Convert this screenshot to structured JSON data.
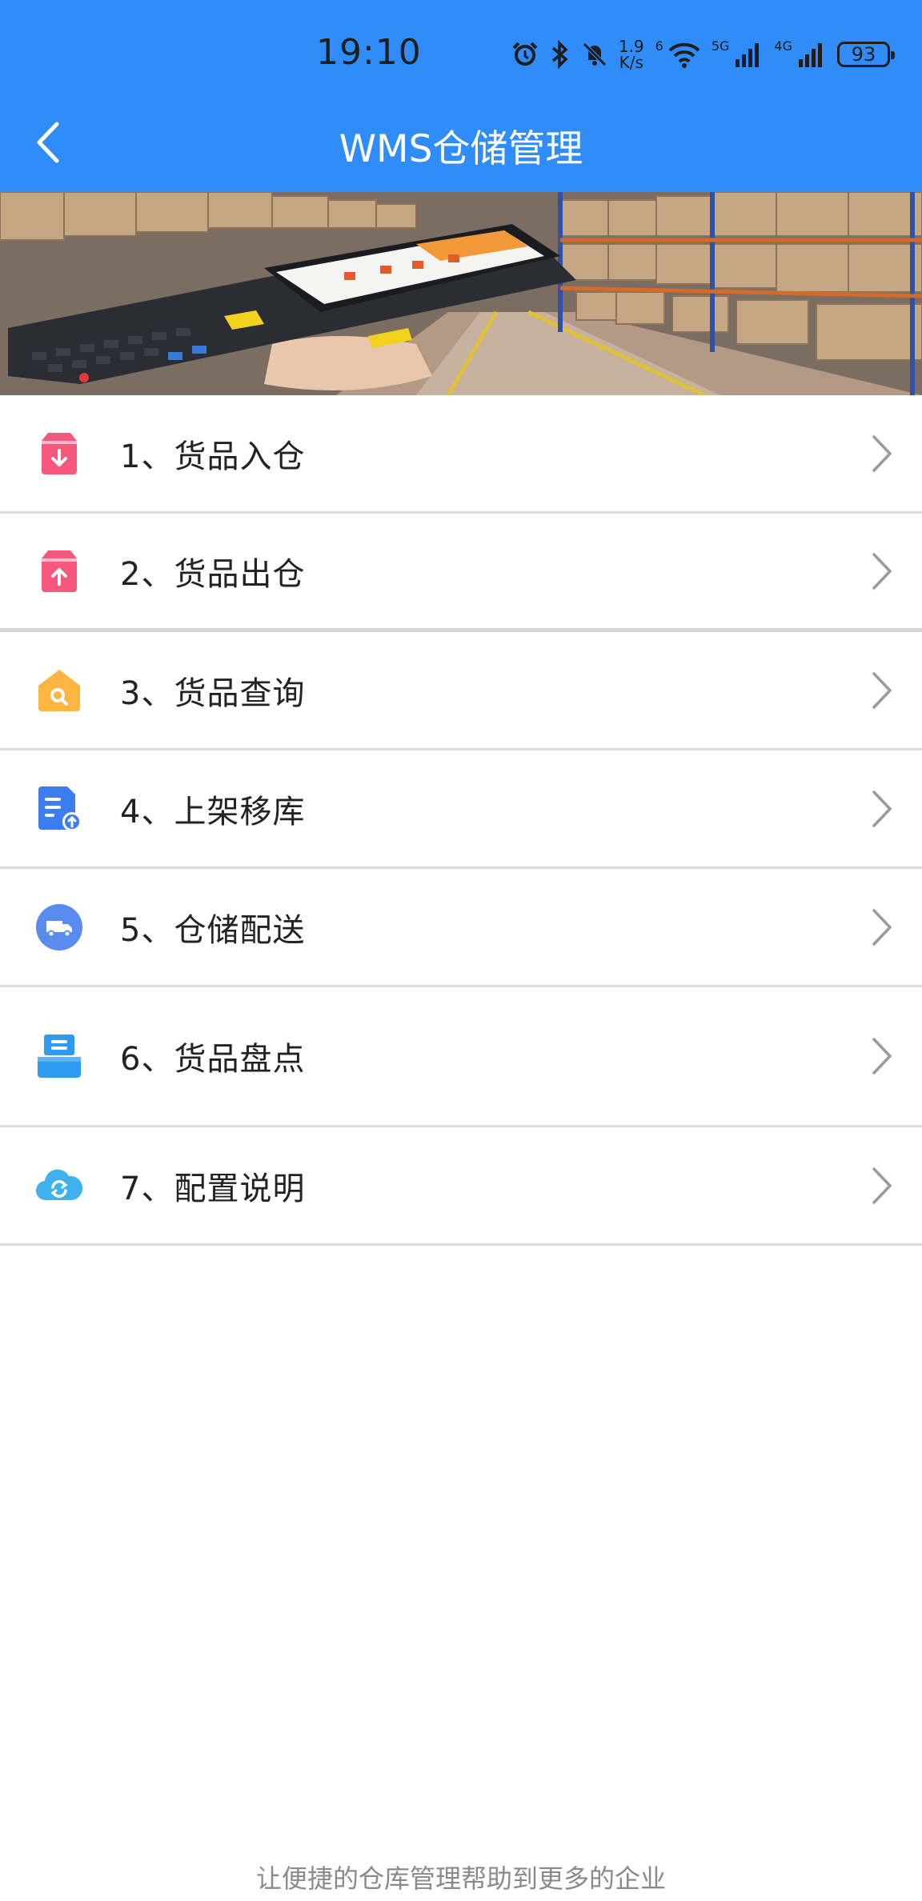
{
  "status_bar": {
    "time": "19:10",
    "net_speed_value": "1.9",
    "net_speed_unit": "K/s",
    "wifi_tag": "6",
    "sim1_label": "5G",
    "sim2_label": "4G",
    "battery": "93"
  },
  "header": {
    "title": "WMS仓储管理",
    "back_icon": "chevron-left-icon",
    "background_color": "#2f8cf9"
  },
  "menu": [
    {
      "label": "1、货品入仓",
      "icon": "box-in-icon",
      "color": "#f5577d"
    },
    {
      "label": "2、货品出仓",
      "icon": "box-out-icon",
      "color": "#f5577d"
    },
    {
      "label": "3、货品查询",
      "icon": "search-tag-icon",
      "color": "#fbb540"
    },
    {
      "label": "4、上架移库",
      "icon": "document-upload-icon",
      "color": "#3d7df2"
    },
    {
      "label": "5、仓储配送",
      "icon": "delivery-truck-icon",
      "color": "#5a8cf0"
    },
    {
      "label": "6、货品盘点",
      "icon": "inventory-box-icon",
      "color": "#2f9af2"
    },
    {
      "label": "7、配置说明",
      "icon": "cloud-sync-icon",
      "color": "#3fb2ee"
    }
  ],
  "footer": {
    "text": "让便捷的仓库管理帮助到更多的企业"
  }
}
